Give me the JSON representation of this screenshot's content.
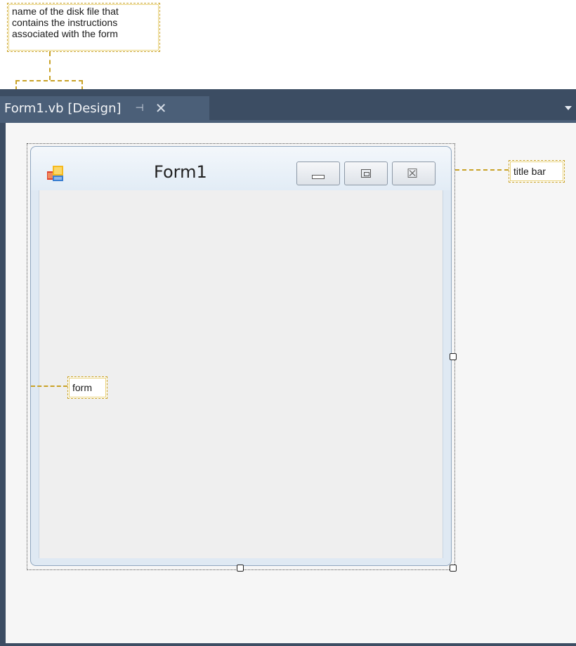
{
  "callouts": {
    "disk_file": {
      "line1": "name of the disk file that",
      "line2": "contains the instructions",
      "line3": "associated with the form"
    },
    "title_bar": "title bar",
    "form": "form"
  },
  "tab": {
    "title": "Form1.vb [Design]",
    "pin_glyph": "⊣",
    "close_glyph": "✕"
  },
  "form": {
    "title": "Form1",
    "close_glyph": "☒"
  },
  "colors": {
    "accent_callout": "#c9a227",
    "ide_dark": "#3c4d63",
    "tab_active": "#4b5f78"
  }
}
